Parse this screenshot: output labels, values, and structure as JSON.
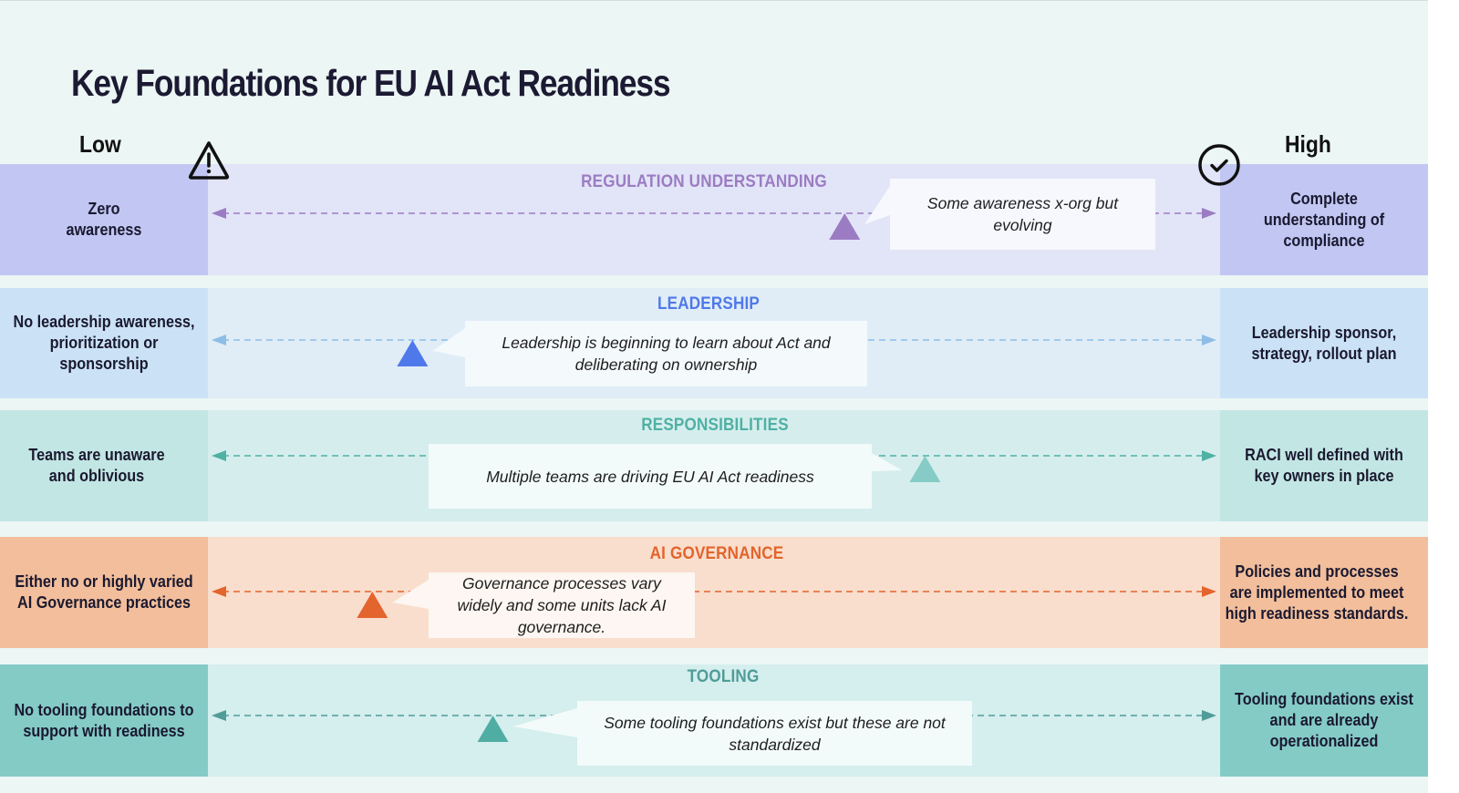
{
  "title": "Key Foundations for EU AI Act Readiness",
  "scale": {
    "low_label": "Low",
    "high_label": "High",
    "low_icon": "warning-triangle-icon",
    "high_icon": "check-circle-icon"
  },
  "rows": [
    {
      "key": "regulation-understanding",
      "title": "REGULATION UNDERSTANDING",
      "low_text": "Zero awareness",
      "high_text": "Complete understanding of compliance",
      "assessment": "Some awareness x-org but evolving",
      "position": 0.63,
      "colors": {
        "accent": "#9b7cc3",
        "band": "#e2e4f7",
        "edge": "#c1c7f2",
        "title": "#9b7cc3",
        "callout": "#f7f8fd"
      }
    },
    {
      "key": "leadership",
      "title": "LEADERSHIP",
      "low_text": "No leadership awareness, prioritization or sponsorship",
      "high_text": "Leadership sponsor, strategy, rollout plan",
      "assessment": "Leadership is beginning to learn about Act and deliberating on ownership",
      "position": 0.2,
      "colors": {
        "accent": "#4f79ea",
        "band": "#e0edf7",
        "edge": "#cbe2f6",
        "title": "#4f79ea",
        "arrow": "#8ebde6",
        "callout": "#f4f9fc"
      }
    },
    {
      "key": "responsibilities",
      "title": "RESPONSIBILITIES",
      "low_text": "Teams are unaware and oblivious",
      "high_text": "RACI well defined with key owners in place",
      "assessment": "Multiple teams are driving EU AI Act readiness",
      "position": 0.71,
      "colors": {
        "accent": "#86cbc5",
        "band": "#d5eeed",
        "edge": "#c2e6e3",
        "title": "#4fb0a4",
        "arrow": "#4fb0a4",
        "callout": "#f2fafa"
      }
    },
    {
      "key": "ai-governance",
      "title": "AI GOVERNANCE",
      "low_text": "Either no or highly varied AI Governance practices",
      "high_text": "Policies and processes are implemented to meet high readiness standards.",
      "assessment": "Governance processes vary widely and some units lack AI governance.",
      "position": 0.16,
      "colors": {
        "accent": "#e3642c",
        "band": "#f9decd",
        "edge": "#f3be9b",
        "title": "#e3642c",
        "arrow": "#e3642c",
        "callout": "#fdf6f2"
      }
    },
    {
      "key": "tooling",
      "title": "TOOLING",
      "low_text": "No tooling foundations to support with readiness",
      "high_text": "Tooling foundations exist and are already operationalized",
      "assessment": "Some tooling foundations exist but these are not standardized",
      "position": 0.28,
      "colors": {
        "accent": "#50ada3",
        "band": "#d5eeee",
        "edge": "#84cbc6",
        "title": "#4f9c98",
        "arrow": "#4f9c98",
        "callout": "#f3fbfa"
      }
    }
  ]
}
